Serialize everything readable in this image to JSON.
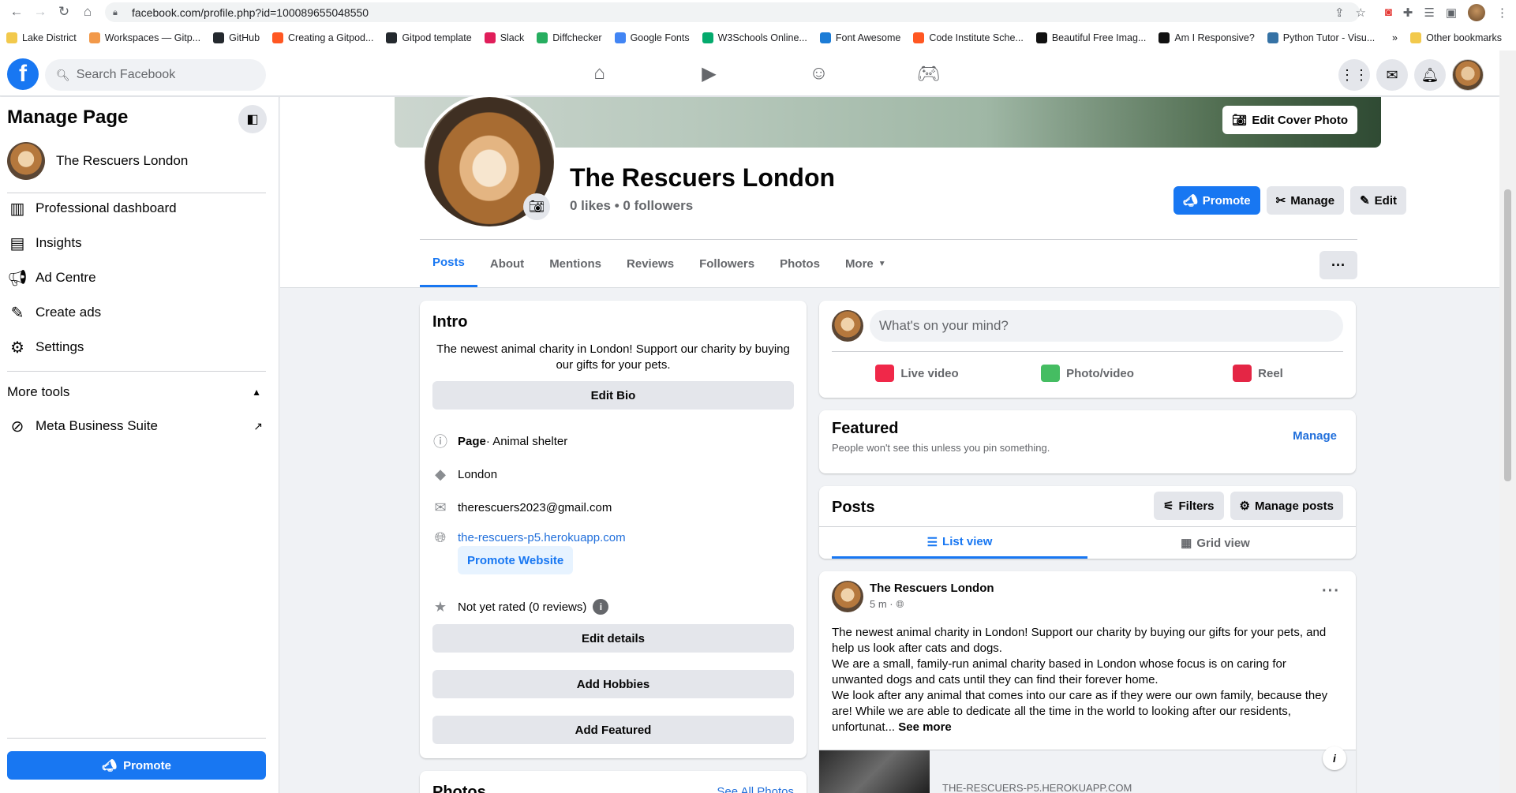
{
  "browser": {
    "url": "facebook.com/profile.php?id=100089655048550",
    "bookmarks": [
      {
        "label": "Lake District",
        "color": "#f2c94c"
      },
      {
        "label": "Workspaces — Gitp...",
        "color": "#f2994a"
      },
      {
        "label": "GitHub",
        "color": "#24292e"
      },
      {
        "label": "Creating a Gitpod...",
        "color": "#ff5722"
      },
      {
        "label": "Gitpod template",
        "color": "#24292e"
      },
      {
        "label": "Slack",
        "color": "#e01e5a"
      },
      {
        "label": "Diffchecker",
        "color": "#27ae60"
      },
      {
        "label": "Google Fonts",
        "color": "#4285f4"
      },
      {
        "label": "W3Schools Online...",
        "color": "#04aa6d"
      },
      {
        "label": "Font Awesome",
        "color": "#1c7cd6"
      },
      {
        "label": "Code Institute Sche...",
        "color": "#ff5722"
      },
      {
        "label": "Beautiful Free Imag...",
        "color": "#111111"
      },
      {
        "label": "Am I Responsive?",
        "color": "#111111"
      },
      {
        "label": "Python Tutor - Visu...",
        "color": "#3572a5"
      }
    ],
    "other_bookmarks": "Other bookmarks",
    "overflow": "»"
  },
  "fb": {
    "logo": "f",
    "search_placeholder": "Search Facebook"
  },
  "sidebar": {
    "title": "Manage Page",
    "page_name": "The Rescuers London",
    "items": [
      {
        "label": "Professional dashboard",
        "icon": "dashboard-icon"
      },
      {
        "label": "Insights",
        "icon": "insights-icon"
      },
      {
        "label": "Ad Centre",
        "icon": "megaphone-icon"
      },
      {
        "label": "Create ads",
        "icon": "edit-icon"
      },
      {
        "label": "Settings",
        "icon": "gear-icon"
      }
    ],
    "more_tools": "More tools",
    "meta_suite": "Meta Business Suite",
    "promote": "Promote"
  },
  "profile": {
    "edit_cover": "Edit Cover Photo",
    "name": "The Rescuers London",
    "stats": "0 likes • 0 followers",
    "promote": "Promote",
    "manage": "Manage",
    "edit": "Edit",
    "tabs": [
      "Posts",
      "About",
      "Mentions",
      "Reviews",
      "Followers",
      "Photos",
      "More"
    ],
    "more_menu": "···"
  },
  "intro": {
    "title": "Intro",
    "bio": "The newest animal charity in London! Support our charity by buying our gifts for your pets.",
    "edit_bio": "Edit Bio",
    "page_label": "Page",
    "category": " · Animal shelter",
    "location": "London",
    "email": "therescuers2023@gmail.com",
    "website": "the-rescuers-p5.herokuapp.com",
    "promote_website": "Promote Website",
    "rating": "Not yet rated (0 reviews)",
    "edit_details": "Edit details",
    "add_hobbies": "Add Hobbies",
    "add_featured": "Add Featured"
  },
  "photos": {
    "title": "Photos",
    "see_all": "See All Photos"
  },
  "composer": {
    "placeholder": "What's on your mind?",
    "live": "Live video",
    "photo": "Photo/video",
    "reel": "Reel"
  },
  "featured": {
    "title": "Featured",
    "subtitle": "People won't see this unless you pin something.",
    "manage": "Manage"
  },
  "posts": {
    "title": "Posts",
    "filters": "Filters",
    "manage_posts": "Manage posts",
    "list_view": "List view",
    "grid_view": "Grid view"
  },
  "post": {
    "author": "The Rescuers London",
    "time": "5 m · ",
    "p1": "The newest animal charity in London! Support our charity by buying our gifts for your pets, and help us look after cats and dogs.",
    "p2": "We are a small, family-run animal charity based in London whose focus is on caring for unwanted dogs and cats until they can find their forever home.",
    "p3": "We look after any animal that comes into our care as if they were our own family, because they are! While we are able to dedicate all the time in the world to looking after our residents, unfortunat... ",
    "see_more": "See more",
    "link_domain": "THE-RESCUERS-P5.HEROKUAPP.COM"
  }
}
